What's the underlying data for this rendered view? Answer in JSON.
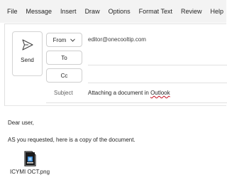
{
  "menu": {
    "items": [
      "File",
      "Message",
      "Insert",
      "Draw",
      "Options",
      "Format Text",
      "Review",
      "Help"
    ]
  },
  "compose": {
    "send_label": "Send",
    "from_label": "From",
    "from_value": "editor@onecooltip.com",
    "to_label": "To",
    "cc_label": "Cc",
    "subject_label": "Subject",
    "subject_prefix": "Attaching a document in ",
    "subject_link": "Outlook"
  },
  "body": {
    "greeting": "Dear user,",
    "text": "AS you requested, here is a copy of the document."
  },
  "attachment": {
    "filename": "ICYMI OCT.png",
    "icon": "image-file-icon"
  },
  "colors": {
    "menubar_bg": "#f3f3f3",
    "accent": "#0f6cbd",
    "spell_underline": "#c50f1f"
  }
}
